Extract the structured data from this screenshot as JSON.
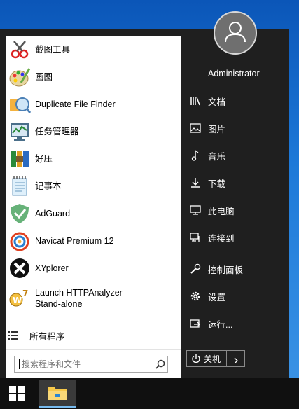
{
  "apps": [
    {
      "name": "截图工具",
      "icon": "snipping-tool-icon"
    },
    {
      "name": "画图",
      "icon": "paint-icon"
    },
    {
      "name": "Duplicate File Finder",
      "icon": "duplicate-file-finder-icon"
    },
    {
      "name": "任务管理器",
      "icon": "task-manager-icon"
    },
    {
      "name": "好压",
      "icon": "haozip-icon"
    },
    {
      "name": "记事本",
      "icon": "notepad-icon"
    },
    {
      "name": "AdGuard",
      "icon": "adguard-icon"
    },
    {
      "name": "Navicat Premium 12",
      "icon": "navicat-icon"
    },
    {
      "name": "XYplorer",
      "icon": "xyplorer-icon"
    },
    {
      "name": "Launch HTTPAnalyzer",
      "name2": "Stand-alone",
      "icon": "httpanalyzer-icon"
    }
  ],
  "all_programs": "所有程序",
  "search": {
    "placeholder": "搜索程序和文件"
  },
  "user": {
    "name": "Administrator"
  },
  "right_items": [
    {
      "label": "文档",
      "icon": "documents-icon"
    },
    {
      "label": "图片",
      "icon": "pictures-icon"
    },
    {
      "label": "音乐",
      "icon": "music-icon"
    },
    {
      "label": "下载",
      "icon": "downloads-icon"
    },
    {
      "label": "此电脑",
      "icon": "computer-icon"
    },
    {
      "label": "连接到",
      "icon": "connect-icon"
    },
    {
      "label": "控制面板",
      "icon": "control-panel-icon"
    },
    {
      "label": "设置",
      "icon": "settings-gear-icon"
    },
    {
      "label": "运行...",
      "icon": "run-icon"
    }
  ],
  "power": {
    "label": "关机"
  },
  "colors": {
    "menu_bg": "#1f1f1f",
    "left_bg": "#ffffff",
    "taskbar": "#101010",
    "accent": "#76b9ed"
  }
}
